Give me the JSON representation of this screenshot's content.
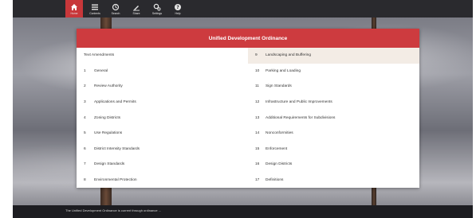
{
  "toolbar": {
    "items": [
      {
        "label": "Home",
        "icon": "home-icon",
        "active": true
      },
      {
        "label": "Contents",
        "icon": "list-icon",
        "active": false
      },
      {
        "label": "Search",
        "icon": "search-icon",
        "active": false
      },
      {
        "label": "Share",
        "icon": "share-icon",
        "active": false
      },
      {
        "label": "Settings",
        "icon": "gear-icon",
        "active": false
      },
      {
        "label": "Help",
        "icon": "help-icon",
        "active": false
      }
    ]
  },
  "panel": {
    "title": "Unified Development Ordinance",
    "accent_color": "#cd3b3f",
    "left_column": [
      {
        "num": "",
        "label": "Text Amendments"
      },
      {
        "num": "1",
        "label": "General"
      },
      {
        "num": "2",
        "label": "Review Authority"
      },
      {
        "num": "3",
        "label": "Applications and Permits"
      },
      {
        "num": "4",
        "label": "Zoning Districts"
      },
      {
        "num": "5",
        "label": "Use Regulations"
      },
      {
        "num": "6",
        "label": "District Intensity Standards"
      },
      {
        "num": "7",
        "label": "Design Standards"
      },
      {
        "num": "8",
        "label": "Environmental Protection"
      }
    ],
    "right_column": [
      {
        "num": "9",
        "label": "Landscaping and Buffering",
        "highlight": true
      },
      {
        "num": "10",
        "label": "Parking and Loading"
      },
      {
        "num": "11",
        "label": "Sign Standards"
      },
      {
        "num": "12",
        "label": "Infrastructure and Public Improvements"
      },
      {
        "num": "13",
        "label": "Additional Requirements for Subdivisions"
      },
      {
        "num": "14",
        "label": "Nonconformities"
      },
      {
        "num": "15",
        "label": "Enforcement"
      },
      {
        "num": "16",
        "label": "Design Districts"
      },
      {
        "num": "17",
        "label": "Definitions"
      }
    ]
  },
  "footer": {
    "text": "The Unified Development Ordinance is current through ordinance ..."
  }
}
